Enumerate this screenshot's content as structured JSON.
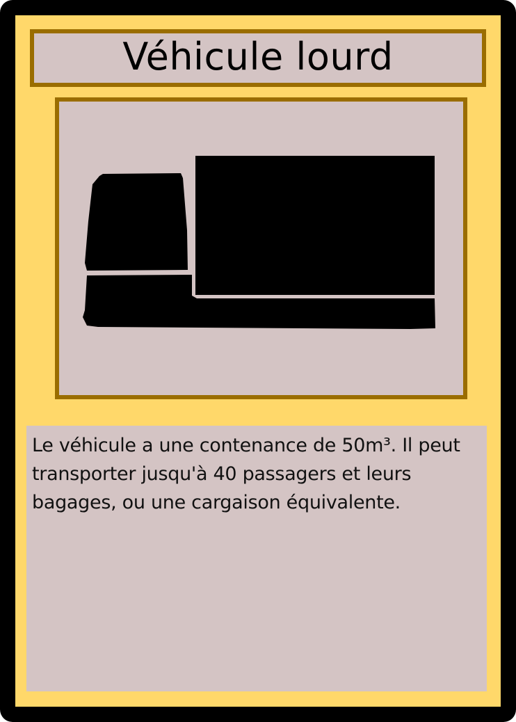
{
  "card": {
    "title": "Véhicule lourd",
    "description": "Le véhicule a une contenance de 50m³. Il peut transporter jusqu'à 40 passagers et leurs bagages, ou une cargaison équivalente.",
    "illustration_icon": "truck-icon"
  },
  "colors": {
    "outer_border": "#000000",
    "card_background": "#ffd86a",
    "frame_border": "#9a6d00",
    "panel_background": "#d4c4c4",
    "text": "#000000"
  }
}
